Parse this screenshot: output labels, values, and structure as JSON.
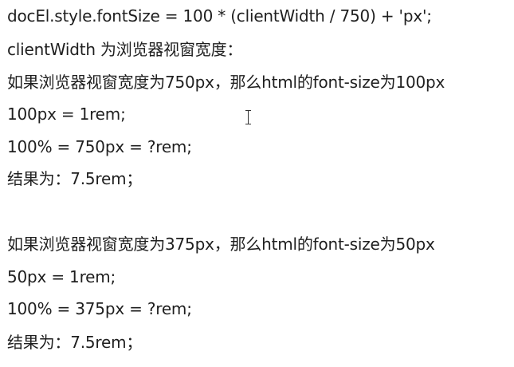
{
  "lines": [
    "docEl.style.fontSize = 100 * (clientWidth / 750) + 'px';",
    "clientWidth 为浏览器视窗宽度：",
    "如果浏览器视窗宽度为750px，那么html的font-size为100px",
    "100px = 1rem;",
    "100% = 750px = ?rem;",
    "结果为：7.5rem；",
    "如果浏览器视窗宽度为375px，那么html的font-size为50px",
    "50px = 1rem;",
    "100% = 375px = ?rem;",
    "结果为：7.5rem；"
  ]
}
